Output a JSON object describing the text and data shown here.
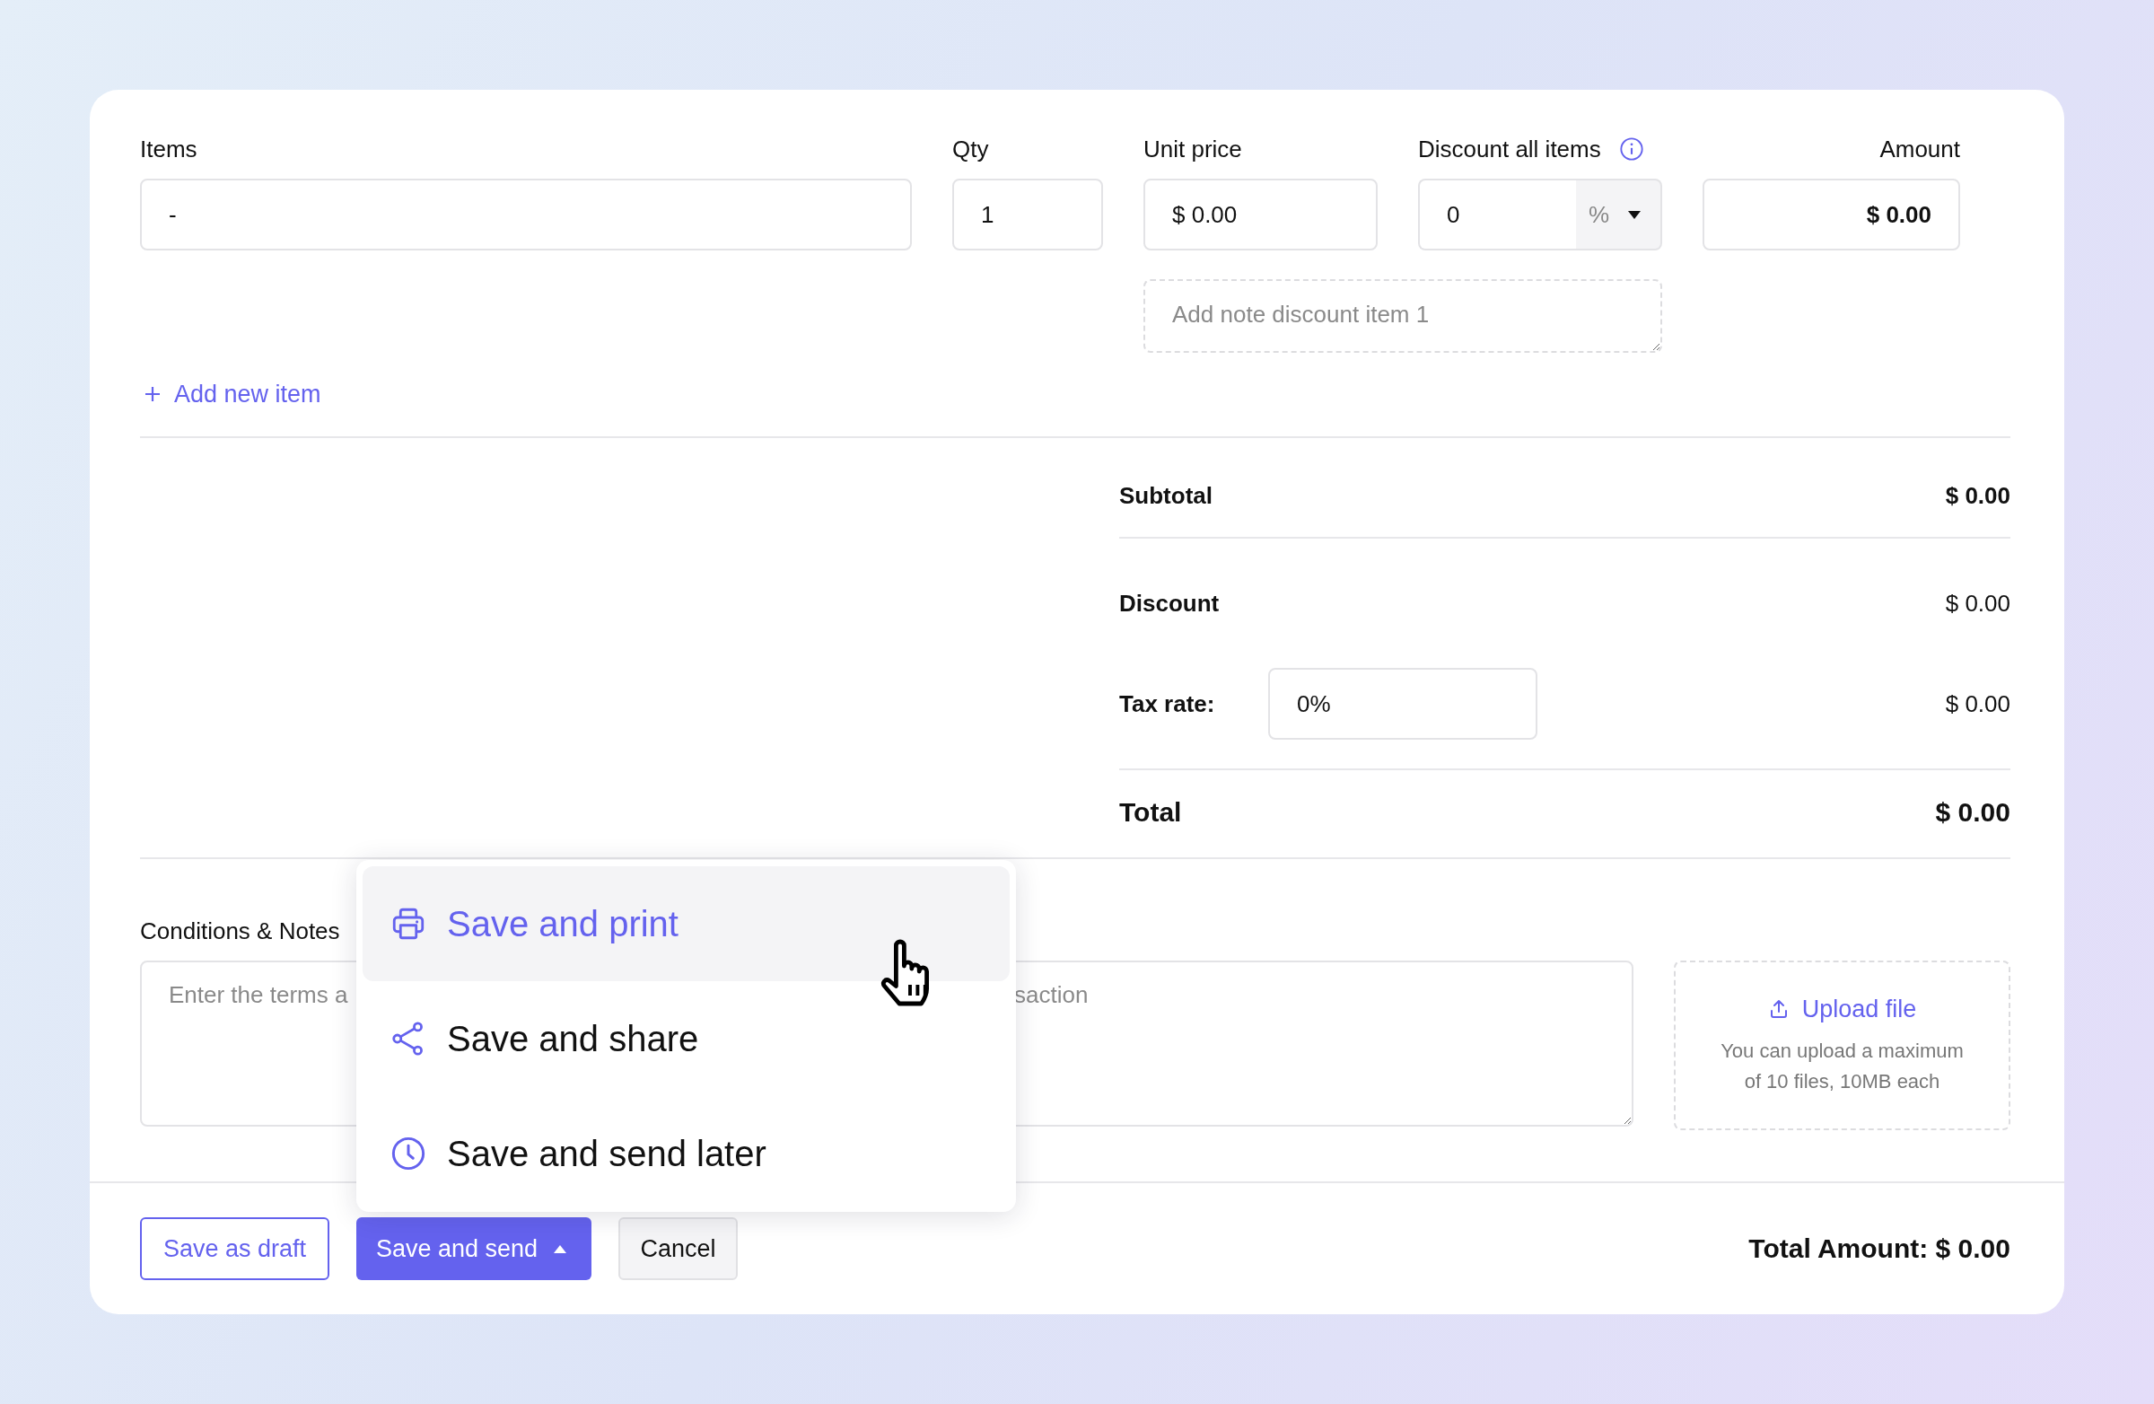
{
  "columns": [
    {
      "label": "Items"
    },
    {
      "label": "Qty"
    },
    {
      "label": "Unit price"
    },
    {
      "label": "Discount all items",
      "info": true
    },
    {
      "label": "Amount"
    }
  ],
  "item": {
    "name": "-",
    "qty": "1",
    "unit_price": "$ 0.00",
    "discount": "0",
    "discount_unit": "%",
    "amount": "$ 0.00",
    "note_placeholder": "Add note discount item 1"
  },
  "add_item": "Add new item",
  "summary": {
    "subtotal": {
      "label": "Subtotal",
      "value": "$ 0.00"
    },
    "discount": {
      "label": "Discount",
      "value": "$ 0.00"
    },
    "tax": {
      "label": "Tax rate:",
      "input": "0%",
      "value": "$ 0.00"
    },
    "total": {
      "label": "Total",
      "value": "$ 0.00"
    }
  },
  "notes": {
    "label": "Conditions & Notes",
    "placeholder_parts": [
      "Enter the terms a",
      "saction"
    ]
  },
  "upload": {
    "label": "Upload file",
    "hint": "You can upload a maximum of 10 files, 10MB each"
  },
  "footer": {
    "draft": "Save as draft",
    "send": "Save and send",
    "cancel": "Cancel",
    "total_amount": "Total Amount: $ 0.00"
  },
  "send_menu": {
    "open": true,
    "items": [
      {
        "kind": "print",
        "label": "Save and print",
        "selected": true
      },
      {
        "kind": "share",
        "label": "Save and share",
        "selected": false
      },
      {
        "kind": "later",
        "label": "Save and send later",
        "selected": false
      }
    ]
  }
}
